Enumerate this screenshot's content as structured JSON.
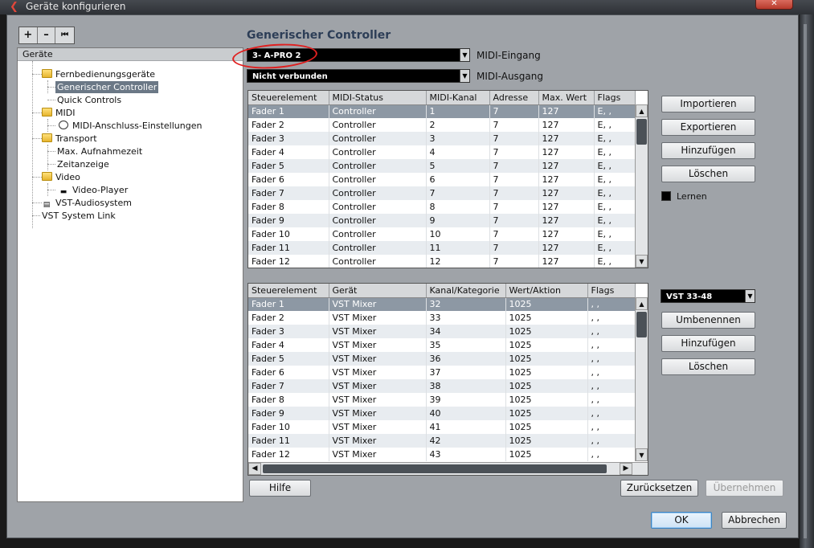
{
  "window": {
    "title": "Geräte konfigurieren",
    "close_glyph": "✕"
  },
  "toolbar": {
    "add": "+",
    "remove": "–",
    "reset": "⏮"
  },
  "tree": {
    "header": "Geräte",
    "items": [
      {
        "label": "Fernbedienungsgeräte",
        "icon": "folder-icon"
      },
      {
        "label": "Generischer Controller",
        "selected": true
      },
      {
        "label": "Quick Controls"
      },
      {
        "label": "MIDI",
        "icon": "folder-icon"
      },
      {
        "label": "MIDI-Anschluss-Einstellungen",
        "icon": "midi-port-icon"
      },
      {
        "label": "Transport",
        "icon": "folder-icon"
      },
      {
        "label": "Max. Aufnahmezeit"
      },
      {
        "label": "Zeitanzeige"
      },
      {
        "label": "Video",
        "icon": "folder-icon"
      },
      {
        "label": "Video-Player",
        "icon": "video-icon"
      },
      {
        "label": "VST-Audiosystem",
        "icon": "audio-system-icon"
      },
      {
        "label": "VST System Link"
      }
    ]
  },
  "main": {
    "title": "Generischer Controller",
    "midi_in": {
      "value": "3- A-PRO 2",
      "label": "MIDI-Eingang"
    },
    "midi_out": {
      "value": "Nicht verbunden",
      "label": "MIDI-Ausgang"
    },
    "table1": {
      "columns": [
        "Steuerelement",
        "MIDI-Status",
        "MIDI-Kanal",
        "Adresse",
        "Max. Wert",
        "Flags"
      ],
      "rows": [
        [
          "Fader 1",
          "Controller",
          "1",
          "7",
          "127",
          "E, ,"
        ],
        [
          "Fader 2",
          "Controller",
          "2",
          "7",
          "127",
          "E, ,"
        ],
        [
          "Fader 3",
          "Controller",
          "3",
          "7",
          "127",
          "E, ,"
        ],
        [
          "Fader 4",
          "Controller",
          "4",
          "7",
          "127",
          "E, ,"
        ],
        [
          "Fader 5",
          "Controller",
          "5",
          "7",
          "127",
          "E, ,"
        ],
        [
          "Fader 6",
          "Controller",
          "6",
          "7",
          "127",
          "E, ,"
        ],
        [
          "Fader 7",
          "Controller",
          "7",
          "7",
          "127",
          "E, ,"
        ],
        [
          "Fader 8",
          "Controller",
          "8",
          "7",
          "127",
          "E, ,"
        ],
        [
          "Fader 9",
          "Controller",
          "9",
          "7",
          "127",
          "E, ,"
        ],
        [
          "Fader 10",
          "Controller",
          "10",
          "7",
          "127",
          "E, ,"
        ],
        [
          "Fader 11",
          "Controller",
          "11",
          "7",
          "127",
          "E, ,"
        ],
        [
          "Fader 12",
          "Controller",
          "12",
          "7",
          "127",
          "E, ,"
        ]
      ]
    },
    "table2": {
      "columns": [
        "Steuerelement",
        "Gerät",
        "Kanal/Kategorie",
        "Wert/Aktion",
        "Flags"
      ],
      "rows": [
        [
          "Fader 1",
          "VST Mixer",
          "32",
          "1025",
          ", ,"
        ],
        [
          "Fader 2",
          "VST Mixer",
          "33",
          "1025",
          ", ,"
        ],
        [
          "Fader 3",
          "VST Mixer",
          "34",
          "1025",
          ", ,"
        ],
        [
          "Fader 4",
          "VST Mixer",
          "35",
          "1025",
          ", ,"
        ],
        [
          "Fader 5",
          "VST Mixer",
          "36",
          "1025",
          ", ,"
        ],
        [
          "Fader 6",
          "VST Mixer",
          "37",
          "1025",
          ", ,"
        ],
        [
          "Fader 7",
          "VST Mixer",
          "38",
          "1025",
          ", ,"
        ],
        [
          "Fader 8",
          "VST Mixer",
          "39",
          "1025",
          ", ,"
        ],
        [
          "Fader 9",
          "VST Mixer",
          "40",
          "1025",
          ", ,"
        ],
        [
          "Fader 10",
          "VST Mixer",
          "41",
          "1025",
          ", ,"
        ],
        [
          "Fader 11",
          "VST Mixer",
          "42",
          "1025",
          ", ,"
        ],
        [
          "Fader 12",
          "VST Mixer",
          "43",
          "1025",
          ", ,"
        ]
      ]
    },
    "buttons_top": {
      "import": "Importieren",
      "export": "Exportieren",
      "add": "Hinzufügen",
      "delete": "Löschen",
      "learn": "Lernen"
    },
    "bank_select": "VST 33-48",
    "buttons_bank": {
      "rename": "Umbenennen",
      "add": "Hinzufügen",
      "delete": "Löschen"
    },
    "help": "Hilfe",
    "reset": "Zurücksetzen",
    "apply": "Übernehmen"
  },
  "footer": {
    "ok": "OK",
    "cancel": "Abbrechen"
  }
}
